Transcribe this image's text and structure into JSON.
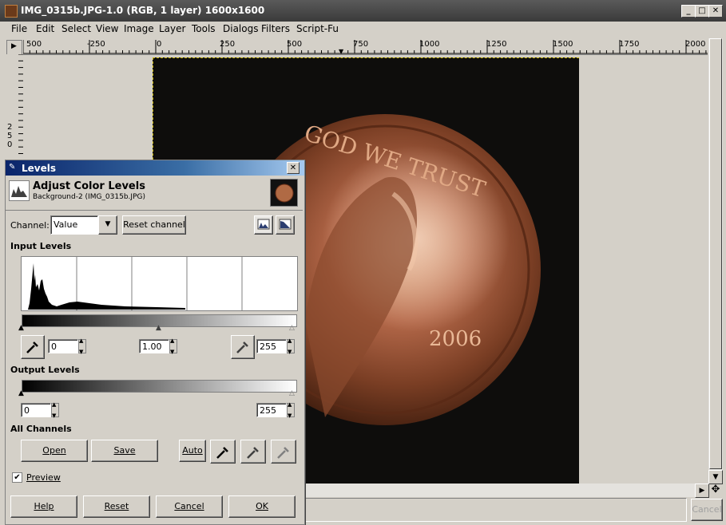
{
  "window": {
    "title": "IMG_0315b.JPG-1.0 (RGB, 1 layer) 1600x1600",
    "menu": [
      "File",
      "Edit",
      "Select",
      "View",
      "Image",
      "Layer",
      "Tools",
      "Dialogs",
      "Filters",
      "Script-Fu"
    ],
    "ruler_h": [
      "500",
      "-250",
      "0",
      "250",
      "500",
      "750",
      "1000",
      "1250",
      "1500",
      "1750",
      "2000"
    ],
    "ruler_v": [
      "2",
      "5",
      "0"
    ],
    "cancel_label": "Cancel"
  },
  "levels": {
    "title": "Levels",
    "heading": "Adjust Color Levels",
    "subheading": "Background-2 (IMG_0315b.JPG)",
    "channel_label": "Channel:",
    "channel_value": "Value",
    "reset_channel": "Reset channel",
    "input_levels": "Input Levels",
    "input_low": "0",
    "input_gamma": "1.00",
    "input_high": "255",
    "output_levels": "Output Levels",
    "output_low": "0",
    "output_high": "255",
    "all_channels": "All Channels",
    "open": "Open",
    "save": "Save",
    "auto": "Auto",
    "preview": "Preview",
    "preview_checked": true,
    "help": "Help",
    "reset": "Reset",
    "cancel": "Cancel",
    "ok": "OK"
  },
  "photo": {
    "coin_motto": "GOD WE TRUST",
    "coin_year": "2006"
  }
}
